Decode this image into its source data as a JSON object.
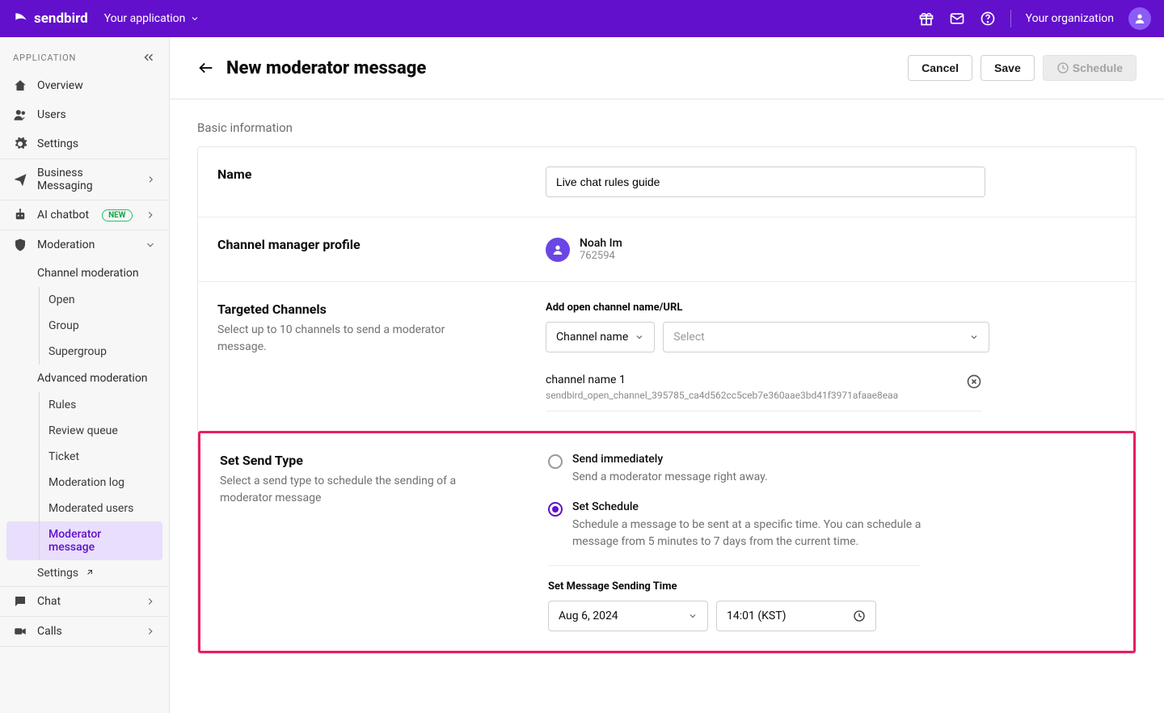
{
  "header": {
    "brand": "sendbird",
    "app_switch_label": "Your application",
    "org_label": "Your organization"
  },
  "sidebar": {
    "section_label": "APPLICATION",
    "overview": "Overview",
    "users": "Users",
    "settings": "Settings",
    "business_messaging": "Business Messaging",
    "ai_chatbot": "AI chatbot",
    "ai_badge": "NEW",
    "moderation": "Moderation",
    "channel_moderation": "Channel moderation",
    "cm_open": "Open",
    "cm_group": "Group",
    "cm_supergroup": "Supergroup",
    "advanced_moderation": "Advanced moderation",
    "am_rules": "Rules",
    "am_review_queue": "Review queue",
    "am_ticket": "Ticket",
    "am_moderation_log": "Moderation log",
    "am_moderated_users": "Moderated users",
    "am_moderator_message": "Moderator message",
    "mod_settings": "Settings",
    "chat": "Chat",
    "calls": "Calls"
  },
  "page": {
    "title": "New moderator message",
    "cancel": "Cancel",
    "save": "Save",
    "schedule": "Schedule"
  },
  "basic_info_label": "Basic information",
  "name_row": {
    "title": "Name",
    "value": "Live chat rules guide"
  },
  "profile_row": {
    "title": "Channel manager  profile",
    "name": "Noah Im",
    "id": "762594"
  },
  "channels_row": {
    "title": "Targeted Channels",
    "desc": "Select up to 10 channels to send a moderator message.",
    "field_label": "Add open channel name/URL",
    "mode": "Channel name",
    "select_placeholder": "Select",
    "chip_name": "channel name 1",
    "chip_url": "sendbird_open_channel_395785_ca4d562cc5ceb7e360aae3bd41f3971afaae8eaa"
  },
  "send_type": {
    "title": "Set Send Type",
    "desc": "Select a send type to schedule the sending of a moderator message",
    "opt_now_label": "Send immediately",
    "opt_now_desc": "Send a moderator message right away.",
    "opt_sched_label": "Set Schedule",
    "opt_sched_desc": "Schedule a message to be sent at a specific time. You can schedule a message from 5 minutes to 7 days from the current time.",
    "time_label": "Set Message Sending Time",
    "date_value": "Aug 6, 2024",
    "time_value": "14:01 (KST)"
  }
}
